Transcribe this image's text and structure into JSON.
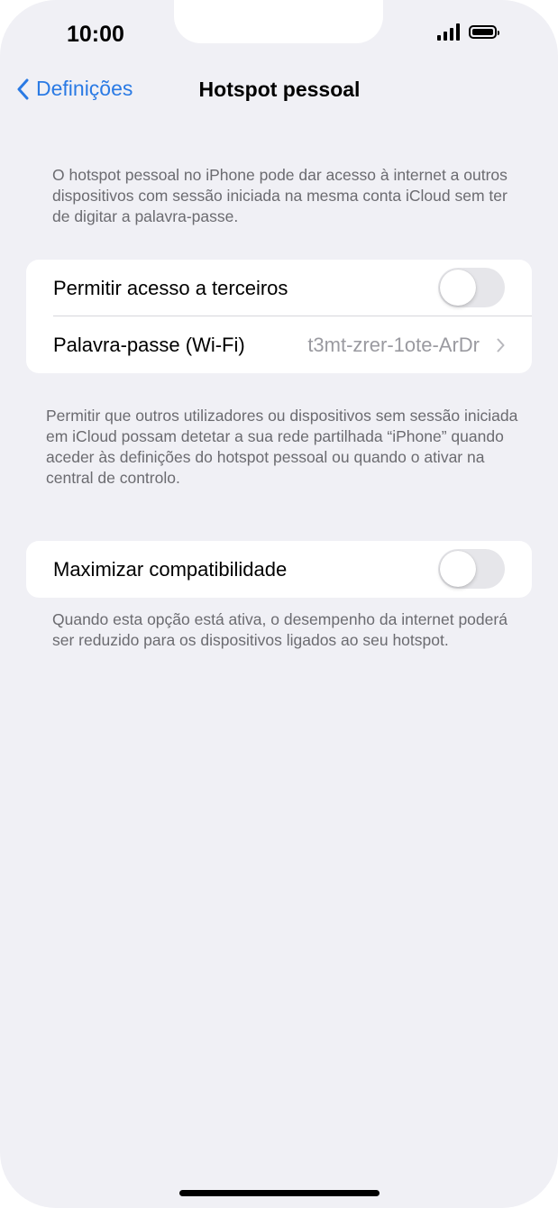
{
  "status_bar": {
    "time": "10:00"
  },
  "nav": {
    "back_label": "Definições",
    "title": "Hotspot pessoal"
  },
  "intro_text": "O hotspot pessoal no iPhone pode dar acesso à internet a outros dispositivos com sessão iniciada na mesma conta iCloud sem ter de digitar a palavra-passe.",
  "group1": {
    "allow_label": "Permitir acesso a terceiros",
    "allow_on": false,
    "password_label": "Palavra-passe (Wi-Fi)",
    "password_value": "t3mt-zrer-1ote-ArDr"
  },
  "group1_footer": "Permitir que outros utilizadores ou dispositivos sem sessão iniciada em iCloud possam detetar a sua rede partilhada “iPhone” quando aceder às definições do hotspot pessoal ou quando o ativar na central de controlo.",
  "group2": {
    "compat_label": "Maximizar compatibilidade",
    "compat_on": false
  },
  "group2_footer": "Quando esta opção está ativa, o desempenho da internet poderá ser reduzido para os dispositivos ligados ao seu hotspot.",
  "colors": {
    "accent": "#2a7ae4",
    "background": "#f0f0f5",
    "toggle_off": "#e6e6ea"
  }
}
